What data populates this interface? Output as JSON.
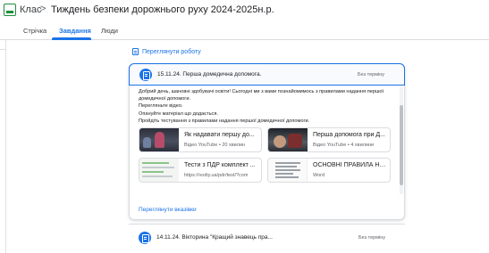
{
  "header": {
    "breadcrumb_class": "Клас",
    "breadcrumb_separator": ">",
    "course_title": "Тиждень безпеки дорожнього руху 2024-2025н.р."
  },
  "tabs": [
    {
      "label": "Стрічка",
      "active": false
    },
    {
      "label": "Завдання",
      "active": true
    },
    {
      "label": "Люди",
      "active": false
    }
  ],
  "view_work": {
    "label": "Переглянути роботу",
    "icon": "assignment-icon"
  },
  "assignment1": {
    "title": "15.11.24. Перша домедична допомога.",
    "due": "Без терміну",
    "description": [
      "Добрий день, шановні здобувачі  освіти! Сьогодні ми з вами познайомимось з правилами надання першої",
      "домедичної допомоги.",
      "Перегляньте відео.",
      "Опануйте матеріал що додається.",
      "Пройдіть тестування з правилами надання першої домедичної допомоги."
    ],
    "attachments": [
      {
        "title": "Як надавати першу до...",
        "subtitle": "Відео YouTube • 20 хвилин",
        "kind": "video"
      },
      {
        "title": "Перша допомога при Д...",
        "subtitle": "Відео YouTube • 4 хвилини",
        "kind": "video"
      },
      {
        "title": "Тести з ПДР комплект ...",
        "subtitle": "https://vodiy.ua/pdr/test/?com",
        "kind": "link"
      },
      {
        "title": "ОСНОВНІ ПРАВИЛА НА...",
        "subtitle": "Word",
        "kind": "doc"
      }
    ],
    "view_instructions": "Переглянути вказівки"
  },
  "assignment2": {
    "title": "14.11.24. Вікторина \"Кращий знавець пра...",
    "due": "Без терміну"
  },
  "colors": {
    "accent": "#1a73e8",
    "brand": "#1e8e3e"
  }
}
